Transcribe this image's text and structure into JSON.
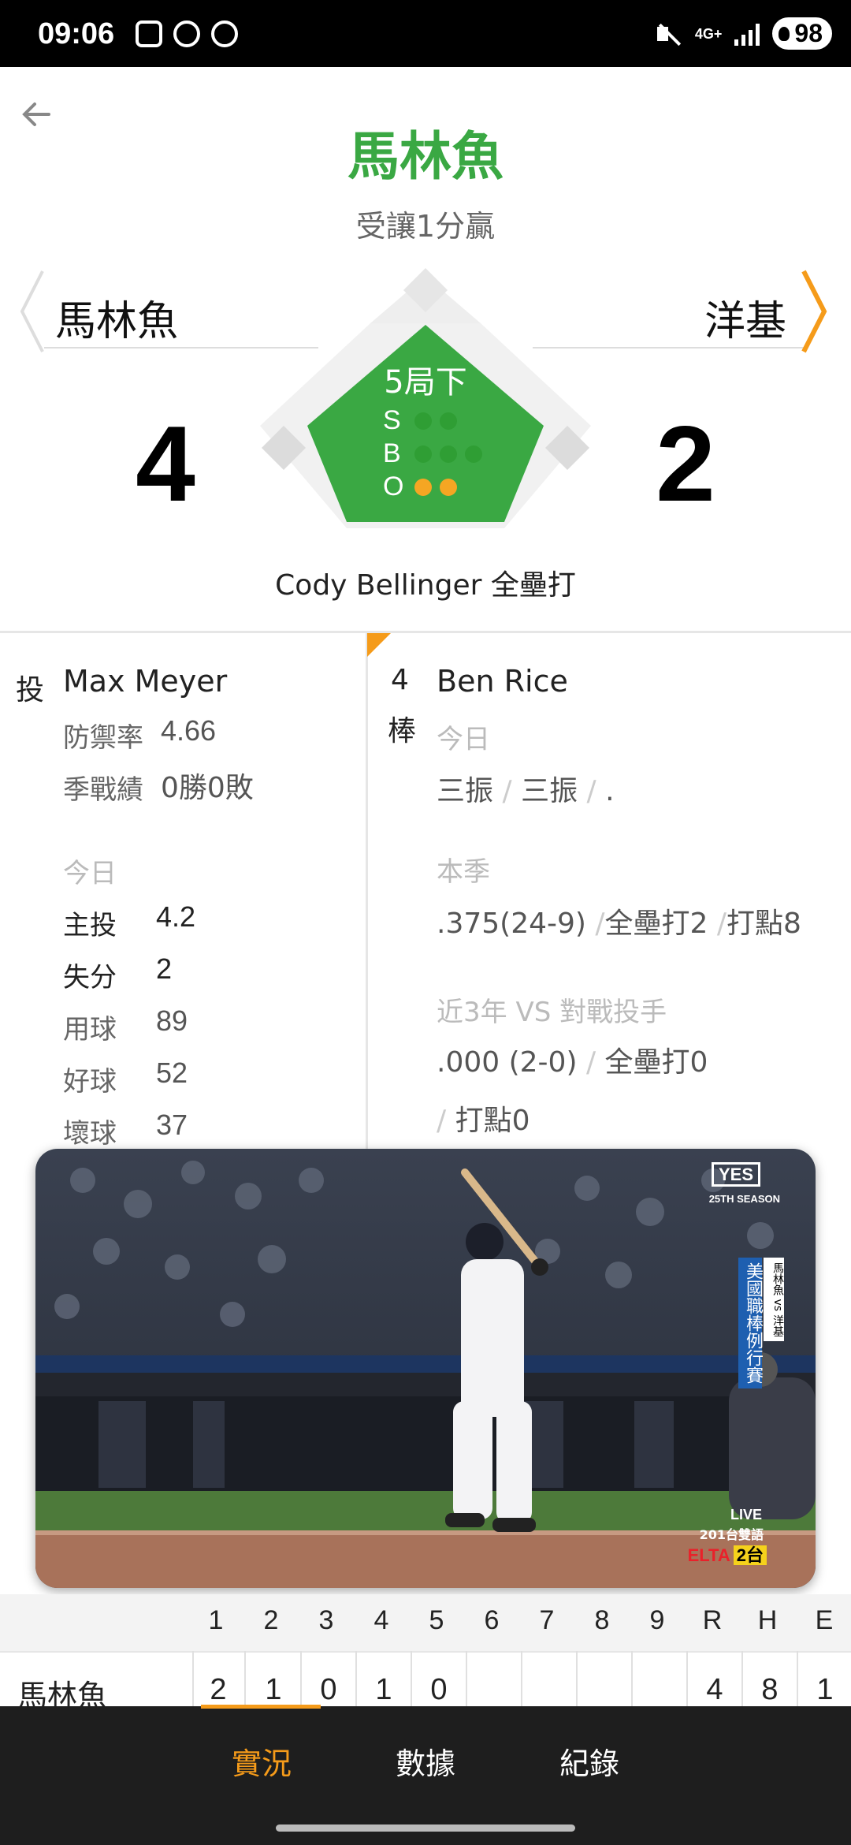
{
  "status_bar": {
    "time": "09:06",
    "network": "4G+",
    "battery": "98"
  },
  "header": {
    "winner": "馬林魚",
    "subtitle": "受讓1分贏"
  },
  "matchup": {
    "away_team": "馬林魚",
    "home_team": "洋基",
    "away_score": "4",
    "home_score": "2",
    "inning": "5局下",
    "count": {
      "s_label": "S",
      "b_label": "B",
      "o_label": "O",
      "strikes": 0,
      "balls": 0,
      "outs": 2
    },
    "last_play": "Cody Bellinger 全壘打"
  },
  "pitcher": {
    "role": "投",
    "name": "Max Meyer",
    "era_label": "防禦率",
    "era": "4.66",
    "record_label": "季戰績",
    "record": "0勝0敗",
    "today_label": "今日",
    "today": [
      {
        "label": "主投",
        "value": "4.2"
      },
      {
        "label": "失分",
        "value": "2"
      },
      {
        "label": "用球",
        "value": "89"
      },
      {
        "label": "好球",
        "value": "52"
      },
      {
        "label": "壞球",
        "value": "37"
      }
    ]
  },
  "batter": {
    "order_num": "4",
    "order_suffix": "棒",
    "name": "Ben Rice",
    "today_label": "今日",
    "today_results": [
      "三振",
      "三振",
      "."
    ],
    "season_label": "本季",
    "season_avg": ".375(24-9)",
    "season_hr": "全壘打2",
    "season_rbi": "打點8",
    "vs_label": "近3年 VS 對戰投手",
    "vs_avg": ".000 (2-0)",
    "vs_hr": "全壘打0",
    "vs_rbi": "打點0",
    "slash": "/"
  },
  "video": {
    "broadcaster": "YES",
    "season_tag": "25TH SEASON",
    "banner": "美國職棒例行賽",
    "banner_teams": "馬林魚 vs 洋基",
    "live": "LIVE",
    "channel_text": "201台雙語",
    "channel_brand": "ELTA",
    "channel_num": "2台"
  },
  "scoreboard": {
    "headers": [
      "1",
      "2",
      "3",
      "4",
      "5",
      "6",
      "7",
      "8",
      "9",
      "R",
      "H",
      "E"
    ],
    "rows": [
      {
        "team": "馬林魚",
        "cells": [
          "2",
          "1",
          "0",
          "1",
          "0",
          "",
          "",
          "",
          "",
          "4",
          "8",
          "1"
        ]
      }
    ]
  },
  "nav": {
    "tabs": [
      "實況",
      "數據",
      "紀錄"
    ],
    "active": 0
  },
  "colors": {
    "accent": "#f59b1a",
    "field_green": "#3aa843",
    "winner_green": "#3aa843"
  }
}
